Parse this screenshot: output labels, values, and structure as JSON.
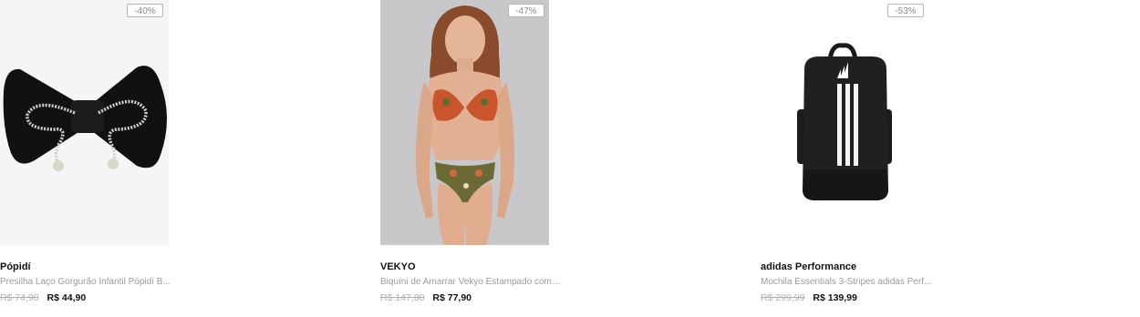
{
  "products": [
    {
      "badge": "-40%",
      "brand": "Pópidí",
      "title": "Presilha Laço Gorgurão Infantil Pópidí B...",
      "old_price": "R$ 74,90",
      "new_price": "R$ 44,90",
      "image_icon": "hair-bow-image"
    },
    {
      "badge": "-47%",
      "brand": "VEKYO",
      "title": "Biquíni de Amarrar Vekyo Estampado com B...",
      "old_price": "R$ 147,80",
      "new_price": "R$ 77,90",
      "image_icon": "bikini-model-image"
    },
    {
      "badge": "-53%",
      "brand": "adidas Performance",
      "title": "Mochila Essentials 3-Stripes adidas Perf...",
      "old_price": "R$ 299,99",
      "new_price": "R$ 139,99",
      "image_icon": "backpack-image"
    }
  ]
}
